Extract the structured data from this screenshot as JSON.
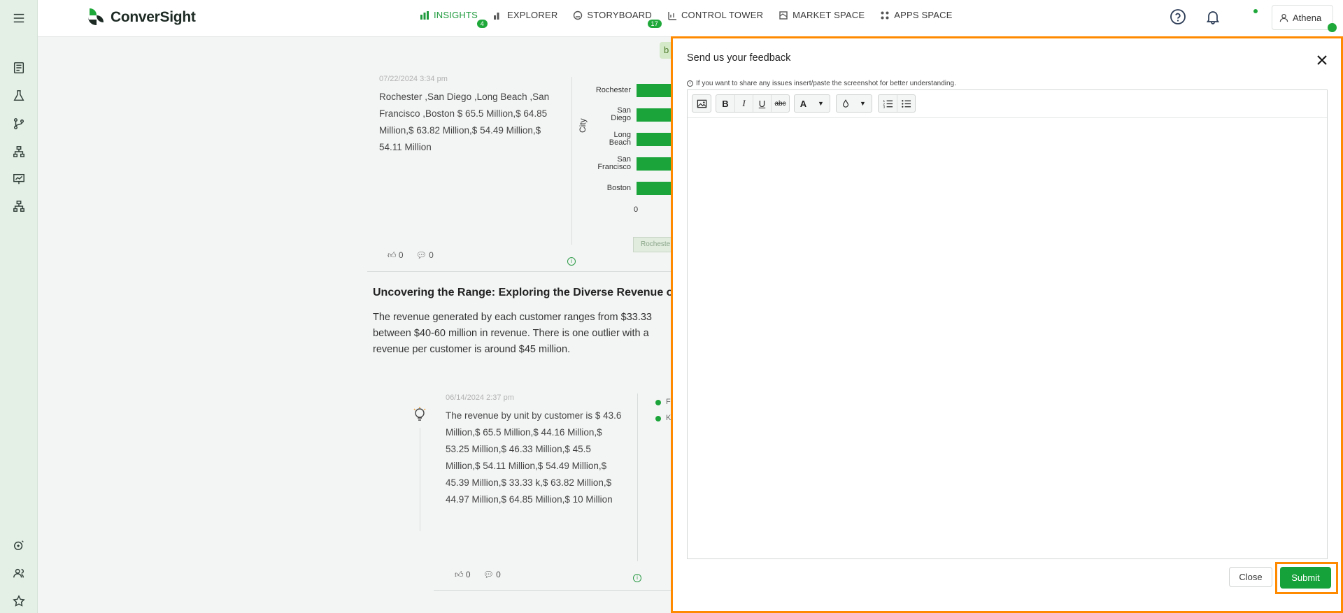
{
  "app": {
    "name": "ConverSight",
    "brand_color": "#1fa83a",
    "highlight_color": "#ff8a00"
  },
  "nav": {
    "items": [
      {
        "label": "INSIGHTS",
        "icon": "bar-chart-icon",
        "badge": "4",
        "active": true
      },
      {
        "label": "EXPLORER",
        "icon": "explorer-icon",
        "badge": ""
      },
      {
        "label": "STORYBOARD",
        "icon": "storyboard-icon",
        "badge": "17"
      },
      {
        "label": "CONTROL TOWER",
        "icon": "control-tower-icon",
        "badge": ""
      },
      {
        "label": "MARKET SPACE",
        "icon": "market-space-icon",
        "badge": ""
      },
      {
        "label": "APPS SPACE",
        "icon": "apps-space-icon",
        "badge": ""
      }
    ],
    "user": "Athena"
  },
  "sidebar": {
    "icons": [
      "menu-icon",
      "report-icon",
      "flask-icon",
      "branch-icon",
      "hierarchy-icon",
      "presentation-icon",
      "org-chart-icon",
      "alert-bot-icon",
      "users-icon",
      "star-icon"
    ]
  },
  "insight1": {
    "date": "07/22/2024 3:34 pm",
    "text": "Rochester ,San Diego ,Long Beach ,San Francisco ,Boston $ 65.5 Million,$ 64.85 Million,$ 63.82 Million,$ 54.49 Million,$ 54.11 Million",
    "likes": "0",
    "comments": "0",
    "chip": "b"
  },
  "chart_data": {
    "type": "bar",
    "categories": [
      "Rochester",
      "San Diego",
      "Long Beach",
      "San Francisco",
      "Boston"
    ],
    "values": [
      65.5,
      64.85,
      63.82,
      54.49,
      54.11
    ],
    "ylabel": "City",
    "x_tick_first": "0",
    "slider_label": "Rocheste"
  },
  "section": {
    "title": "Uncovering the Range: Exploring the Diverse Revenue of",
    "body_lines": [
      "The revenue generated by each customer ranges from $33.33",
      "between $40-60 million in revenue. There is one outlier with a",
      "revenue per customer is around $45 million."
    ]
  },
  "insight2": {
    "date": "06/14/2024 2:37 pm",
    "text": "The revenue by unit by customer is $ 43.6 Million,$ 65.5 Million,$ 44.16 Million,$ 53.25 Million,$ 46.33 Million,$ 45.5 Million,$ 54.11 Million,$ 54.49 Million,$ 45.39 Million,$ 33.33 k,$ 63.82 Million,$ 44.97 Million,$ 64.85 Million,$ 10 Million",
    "likes": "0",
    "comments": "0",
    "legend": [
      "F",
      "K"
    ]
  },
  "feedback_modal": {
    "title": "Send us your feedback",
    "hint": "If you want to share any issues insert/paste the screenshot for better understanding.",
    "toolbar": {
      "font_color_letter": "A",
      "buttons": [
        "image-icon",
        "bold-icon",
        "italic-icon",
        "underline-icon",
        "strikethrough-icon",
        "font-color-icon",
        "highlight-color-icon",
        "numbered-list-icon",
        "bulleted-list-icon"
      ],
      "bold": "B",
      "italic": "I",
      "underline": "U",
      "strike": "abc"
    },
    "close_label": "Close",
    "submit_label": "Submit"
  }
}
